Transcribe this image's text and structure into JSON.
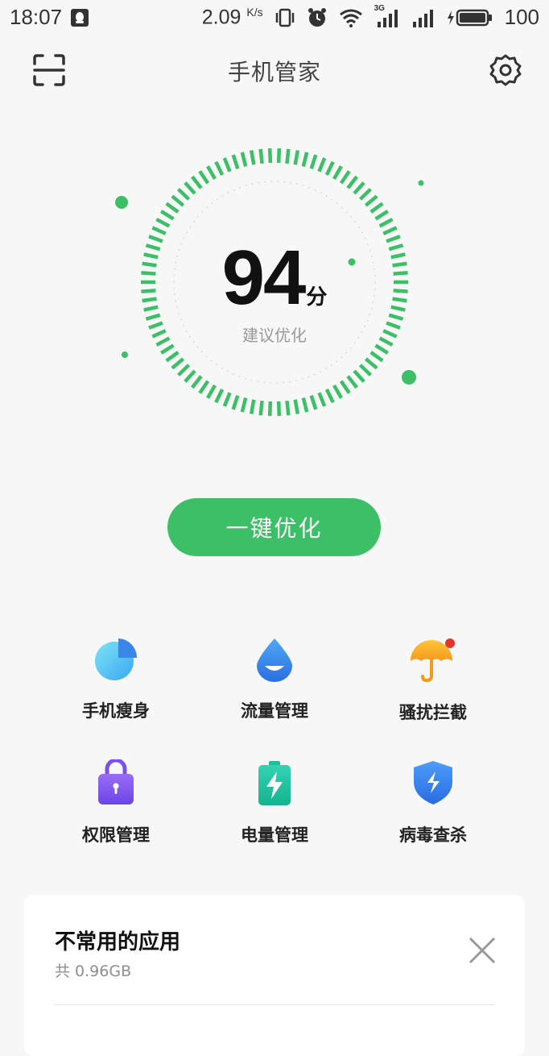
{
  "status_bar": {
    "time": "18:07",
    "speed_value": "2.09",
    "speed_unit": "K/s",
    "network_type": "3G",
    "battery_level": "100"
  },
  "header": {
    "title": "手机管家"
  },
  "score": {
    "value": "94",
    "unit": "分",
    "hint": "建议优化"
  },
  "optimize_button": {
    "label": "一键优化"
  },
  "tools": [
    {
      "label": "手机瘦身",
      "icon": "pie-chart-icon"
    },
    {
      "label": "流量管理",
      "icon": "water-drop-icon"
    },
    {
      "label": "骚扰拦截",
      "icon": "umbrella-icon"
    },
    {
      "label": "权限管理",
      "icon": "lock-icon"
    },
    {
      "label": "电量管理",
      "icon": "battery-charge-icon"
    },
    {
      "label": "病毒查杀",
      "icon": "shield-icon"
    }
  ],
  "card": {
    "title": "不常用的应用",
    "subtitle": "共 0.96GB"
  },
  "colors": {
    "accent": "#3cbf67",
    "background": "#f7f7f7"
  }
}
